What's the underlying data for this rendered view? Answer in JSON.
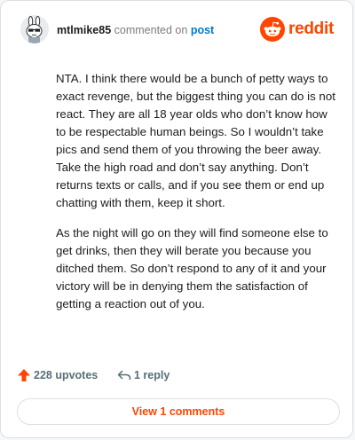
{
  "comment": {
    "author": "mtlmike85",
    "action_text": "commented on",
    "post_link": "post",
    "paragraphs": [
      "NTA. I think there would be a bunch of petty ways to exact revenge, but the biggest thing you can do is not react. They are all 18 year olds who don’t know how to be respectable human beings. So I wouldn’t take pics and send them of you throwing the beer away. Take the high road and don’t say anything. Don’t returns texts or calls, and if you see them or end up chatting with them, keep it short.",
      "As the night will go on they will find someone else to get drinks, then they will berate you because you ditched them. So don’t respond to any of it and your victory will be in denying them the satisfaction of getting a reaction out of you."
    ]
  },
  "brand": {
    "name": "reddit",
    "icon": "reddit-logo-icon",
    "color": "#ff4500"
  },
  "actions": {
    "upvotes_label": "228 upvotes",
    "upvote_icon": "upvote-arrow-icon",
    "replies_label": "1 reply",
    "reply_icon": "reply-arrow-icon"
  },
  "footer": {
    "view_button_label": "View 1 comments"
  },
  "colors": {
    "accent": "#ff4500",
    "link": "#0079d3",
    "text": "#1c1c1c",
    "muted": "#576f76"
  }
}
